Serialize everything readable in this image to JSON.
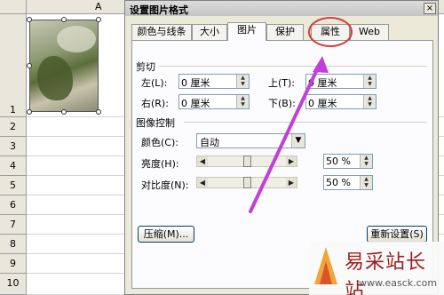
{
  "sheet": {
    "column_label": "A",
    "rows": [
      "1",
      "2",
      "3",
      "4",
      "5",
      "6",
      "7",
      "8",
      "9",
      "10"
    ]
  },
  "dialog": {
    "title": "设置图片格式",
    "close_glyph": "×",
    "tabs": [
      "颜色与线条",
      "大小",
      "图片",
      "保护",
      "属性",
      "Web"
    ],
    "active_tab": "图片",
    "crop": {
      "group_label": "剪切",
      "left_label": "左(L):",
      "left_value": "0 厘米",
      "right_label": "右(R):",
      "right_value": "0 厘米",
      "top_label": "上(T):",
      "top_value": "0 厘米",
      "bottom_label": "下(B):",
      "bottom_value": "0 厘米"
    },
    "image_control": {
      "group_label": "图像控制",
      "color_label": "颜色(C):",
      "color_value": "自动",
      "brightness_label": "亮度(H):",
      "brightness_value": "50 %",
      "brightness_level": 0.5,
      "contrast_label": "对比度(N):",
      "contrast_value": "50 %",
      "contrast_level": 0.5
    },
    "compress_button": "压缩(M)...",
    "reset_button": "重新设置(S)"
  },
  "annotation": {
    "highlight_color": "#d43a3a",
    "arrow_color": "#c040d8"
  },
  "watermark": {
    "title": "易采站长站",
    "url": "www.easck.com"
  }
}
